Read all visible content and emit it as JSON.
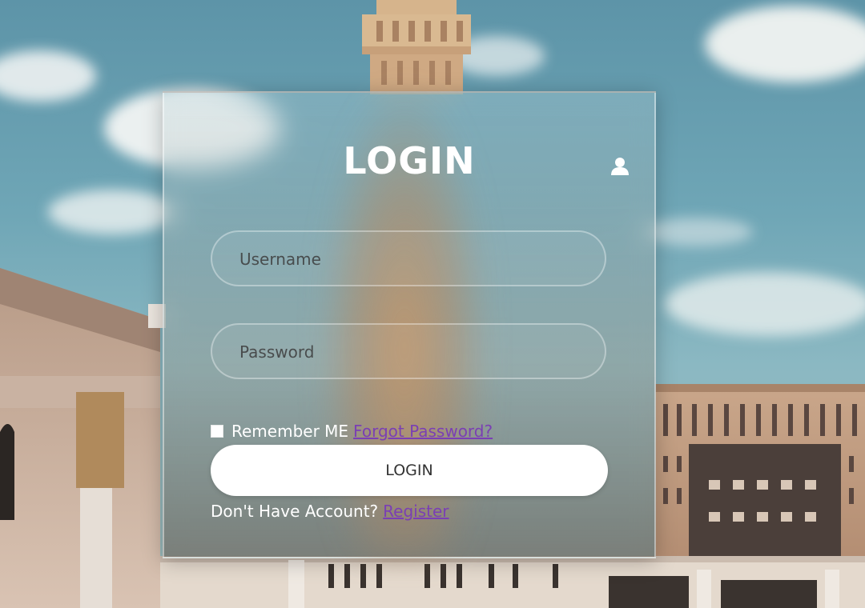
{
  "login_form": {
    "title": "LOGIN",
    "username_placeholder": "Username",
    "password_placeholder": "Password",
    "remember_label": "Remember ME",
    "forgot_link": "Forgot Password?",
    "submit_label": "LOGIN",
    "no_account_text": "Don't Have Account?",
    "register_link": "Register"
  },
  "icons": {
    "corner_icon": "user-icon"
  },
  "colors": {
    "link": "#7a3fb4",
    "button_bg": "#ffffff",
    "title_text": "#ffffff"
  }
}
